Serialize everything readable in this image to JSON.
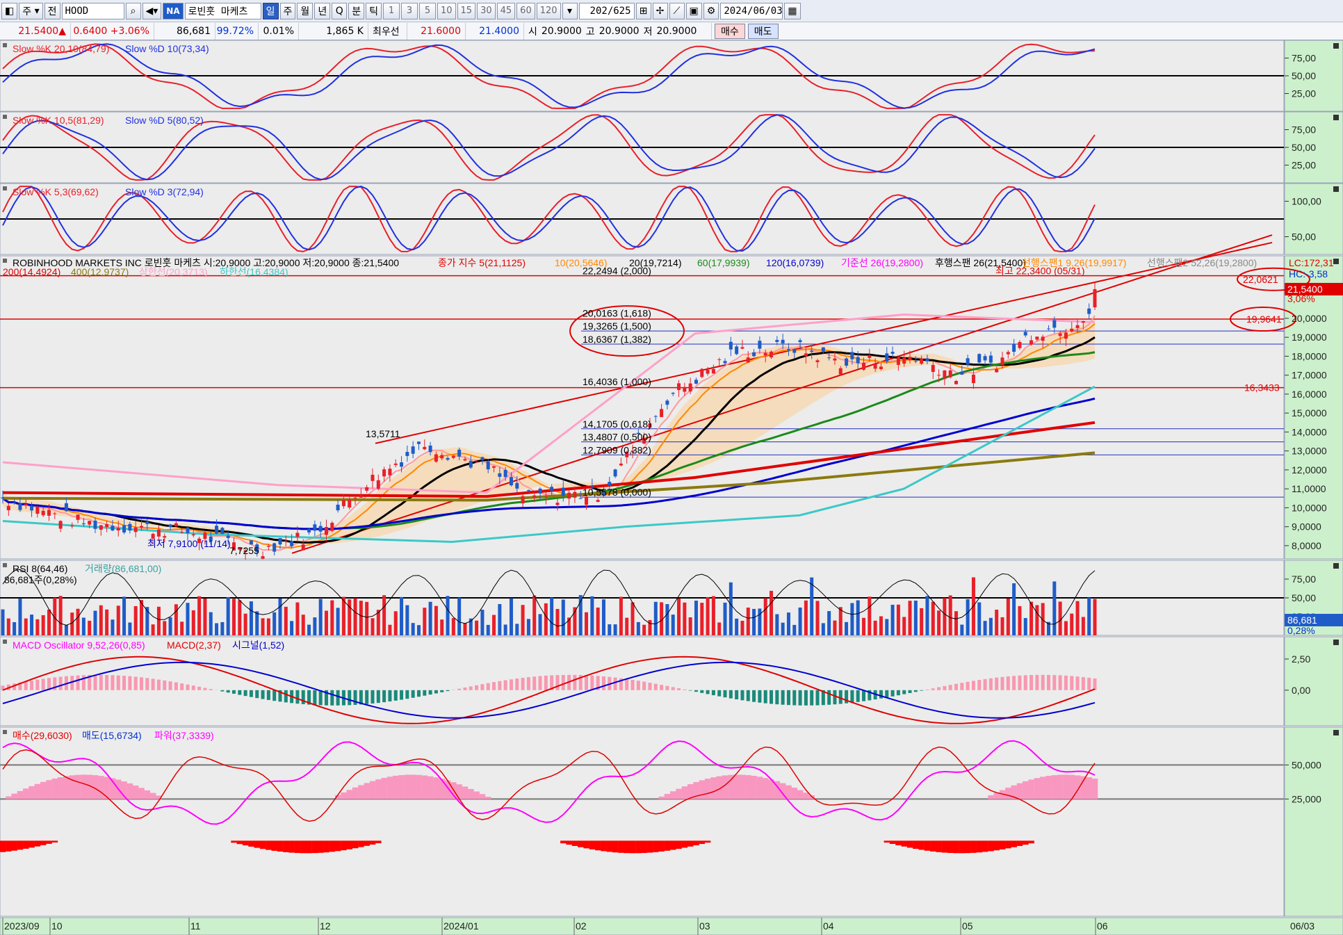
{
  "toolbar": {
    "period_code": "주",
    "all_label": "전",
    "symbol": "HOOD",
    "market_badge": "NA",
    "stock_name": "로빈훗 마케츠",
    "tab_day": "일",
    "tab_week": "주",
    "tab_month": "월",
    "tab_year": "년",
    "tab_q": "Q",
    "tab_minute": "분",
    "tab_tick": "틱",
    "intervals": [
      "1",
      "3",
      "5",
      "10",
      "15",
      "30",
      "45",
      "60",
      "120"
    ],
    "count": "202/625",
    "date": "2024/06/03"
  },
  "quote": {
    "price": "21.5400",
    "change": "0.6400",
    "change_pct": "+3.06%",
    "volume": "86,681",
    "vol_ratio": "99.72%",
    "turnover": "0.01%",
    "vol_k": "1,865 K",
    "best_label": "최우선",
    "ask": "21.6000",
    "bid": "21.4000",
    "open_label": "시",
    "open": "20.9000",
    "high_label": "고",
    "high": "20.9000",
    "low_label": "저",
    "low": "20.9000",
    "buy_button": "매수",
    "sell_button": "매도"
  },
  "panels": {
    "stoch1": {
      "k": "Slow %K 20,10(84,79)",
      "d": "Slow %D 10(73,34)",
      "ticks": [
        "75,00",
        "50,00",
        "25,00"
      ]
    },
    "stoch2": {
      "k": "Slow %K 10,5(81,29)",
      "d": "Slow %D 5(80,52)",
      "ticks": [
        "75,00",
        "50,00",
        "25,00"
      ]
    },
    "stoch3": {
      "k": "Slow %K 5,3(69,62)",
      "d": "Slow %D 3(72,94)",
      "ticks": [
        "100,00",
        "50,00"
      ]
    },
    "price": {
      "title": "ROBINHOOD MARKETS INC  로빈훗 마케츠 시:20,9000 고:20,9000 저:20,9000 종:21,5400",
      "ma_label": "종가 지수 5(21,1125)",
      "ma10": "10(20,5646)",
      "ma20": "20(19,7214)",
      "ma60": "60(17,9939)",
      "ma120": "120(16,0739)",
      "base": "기준선 26(19,2800)",
      "lag": "후행스팬 26(21,5400)",
      "lead1": "선행스팬1 9,26(19,9917)",
      "lead2": "선행스팬2 52,26(19,2800)",
      "ma200": "200(14,4924)",
      "ma400": "400(12,9737)",
      "upper_line": "상한선(20,3713)",
      "lower_line": "하한선(16,4384)",
      "lc": "LC:172,31",
      "hc": "HC:-3,58",
      "last_price": "21,5400",
      "last_pct": "3,06%",
      "right_mark1": "22,0621",
      "right_mark2": "19,9641",
      "right_mark3": "16,3433",
      "high_note": "최고 22,3400 (05/31)",
      "low_note": "최저 7,9100 (11/14)",
      "low_note2": "7,7255",
      "swing_high": "13,5711",
      "fib_top": [
        "22,2494 (2,000)",
        "20,0163 (1,618)",
        "19,3265 (1,500)",
        "18,6367 (1,382)",
        "16,4036 (1,000)"
      ],
      "fib_bot": [
        "14,1705 (0,618)",
        "13,4807 (0,500)",
        "12,7909 (0,382)",
        "10,5578 (0,000)"
      ],
      "ticks": [
        "20,0000",
        "19,0000",
        "18,0000",
        "17,0000",
        "16,0000",
        "15,0000",
        "14,0000",
        "13,0000",
        "12,0000",
        "11,0000",
        "10,0000",
        "9,0000",
        "8,0000"
      ]
    },
    "rsi": {
      "label": "RSI 8(64,46)",
      "vol_label": "거래량(86,681,00)",
      "vol_sub": "86,681주(0,28%)",
      "ticks": [
        "75,00",
        "50,00",
        "25,00"
      ],
      "vol_tag": "86,681",
      "vol_tag2": "0,28%"
    },
    "macd": {
      "osc": "MACD Oscillator 9,52,26(0,85)",
      "macd": "MACD(2,37)",
      "signal": "시그널(1,52)",
      "ticks": [
        "2,50",
        "0,00"
      ]
    },
    "power": {
      "buy": "매수(29,6030)",
      "sell": "매도(15,6734)",
      "power": "파워(37,3339)",
      "ticks": [
        "50,000",
        "25,000"
      ]
    }
  },
  "xaxis": {
    "labels": [
      "2023/09",
      "10",
      "11",
      "12",
      "2024/01",
      "02",
      "03",
      "04",
      "05",
      "06"
    ],
    "right_date": "06/03"
  },
  "colors": {
    "up": "#e8202a",
    "down": "#1f5cc8",
    "magenta": "#ff00ff",
    "cyan": "#3cc8c8",
    "panel_bg": "#ececec",
    "axis_bg": "#ccf0cc"
  }
}
